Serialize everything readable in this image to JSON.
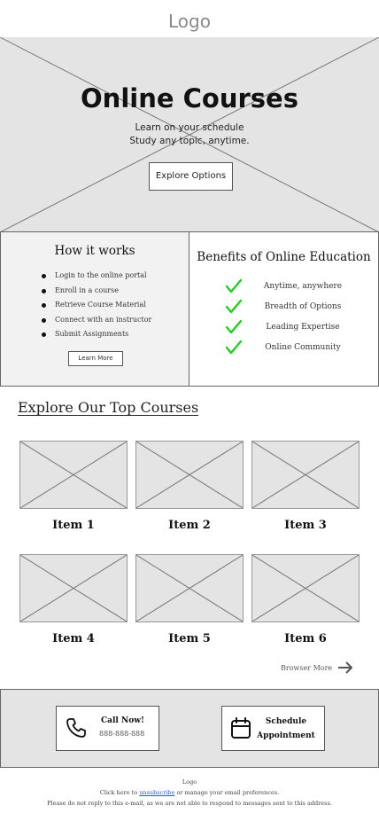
{
  "header": {
    "logo": "Logo"
  },
  "hero": {
    "title": "Online Courses",
    "subtitle_line1": "Learn on your schedule",
    "subtitle_line2": "Study any topic, anytime.",
    "button_label": "Explore Options"
  },
  "how_it_works": {
    "title": "How it works",
    "steps": [
      "Login to the online portal",
      "Enroll in a course",
      "Retrieve Course Material",
      "Connect with an instructor",
      "Submit Assignments"
    ],
    "button_label": "Learn More"
  },
  "benefits": {
    "title": "Benefits of Online Education",
    "items": [
      "Anytime, anywhere",
      "Breadth of Options",
      "Leading Expertise",
      "Online Community"
    ],
    "check_color": "#22cc22"
  },
  "courses": {
    "title": "Explore Our Top Courses",
    "items": [
      "Item 1",
      "Item 2",
      "Item 3",
      "Item 4",
      "Item 5",
      "Item 6"
    ],
    "browse_label": "Browser More"
  },
  "cta": {
    "call_title": "Call Now!",
    "call_number": "888-888-888",
    "schedule_line1": "Schedule",
    "schedule_line2": "Appointment"
  },
  "footer": {
    "logo": "Logo",
    "line1_prefix": "Click here to ",
    "unsubscribe_link": "unsubscribe",
    "line1_suffix": " or manage your email preferences.",
    "line2": "Please do not reply to this e-mail, as we are not able to respond to messages sent to this address."
  }
}
